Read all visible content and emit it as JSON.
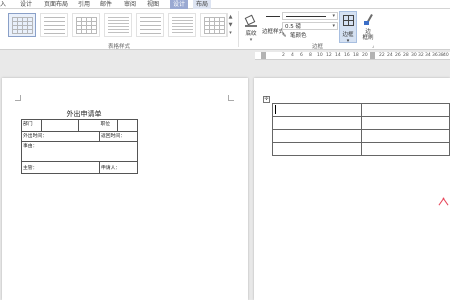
{
  "tabs": [
    {
      "label": "入"
    },
    {
      "label": "设计"
    },
    {
      "label": "页面布局"
    },
    {
      "label": "引用"
    },
    {
      "label": "邮件"
    },
    {
      "label": "审阅"
    },
    {
      "label": "视图"
    },
    {
      "label": "设计"
    },
    {
      "label": "布局"
    }
  ],
  "ribbon": {
    "table_styles_label": "表格样式",
    "shading_label": "底纹",
    "border_style_label": "边框样式",
    "pen_weight": "0.5 磅",
    "pen_color_label": "笔颜色",
    "borders_group_label": "边框",
    "borders_button_label": "边框",
    "border_painter_label_1": "边",
    "border_painter_label_2": "框刷",
    "dropdown_caret": "▾",
    "gallery_up": "▲",
    "gallery_down": "▼",
    "gallery_more": "▾",
    "launcher": "⌟"
  },
  "ruler": {
    "ticks": [
      "2",
      "4",
      "6",
      "8",
      "10",
      "12",
      "14",
      "16",
      "18",
      "20",
      "22",
      "24",
      "26",
      "28",
      "30",
      "32",
      "34",
      "36",
      "38",
      "40",
      "42"
    ]
  },
  "left_page": {
    "form_title": "外出申请单",
    "row1": {
      "c1": "部门",
      "c2": "",
      "c3": "职位",
      "c4": ""
    },
    "row2": {
      "c1": "外出时间：",
      "c2": "返回时间："
    },
    "row3": {
      "c1": "事由："
    },
    "row4": {
      "c1": "主管：",
      "c2": "申请人："
    }
  },
  "right_page": {
    "move_handle": "✣"
  }
}
